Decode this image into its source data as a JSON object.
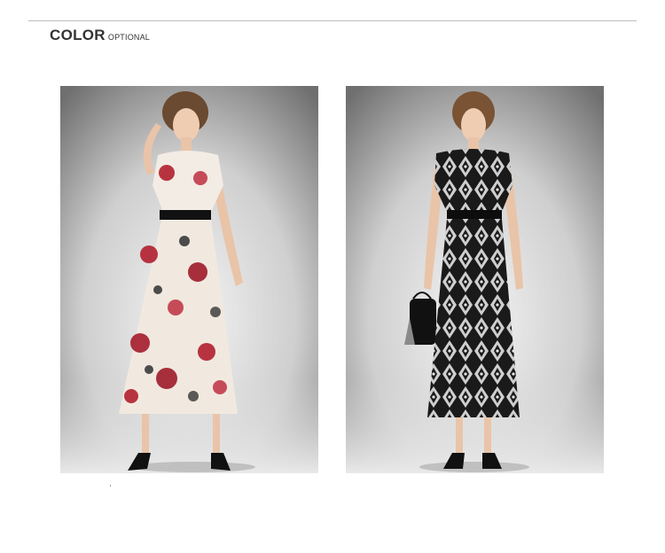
{
  "section": {
    "title": "COLOR",
    "subtitle": "OPTIONAL"
  },
  "options": [
    {
      "id": "floral",
      "icon": "floral-dress-photo"
    },
    {
      "id": "geometric",
      "icon": "geometric-dress-photo"
    }
  ]
}
